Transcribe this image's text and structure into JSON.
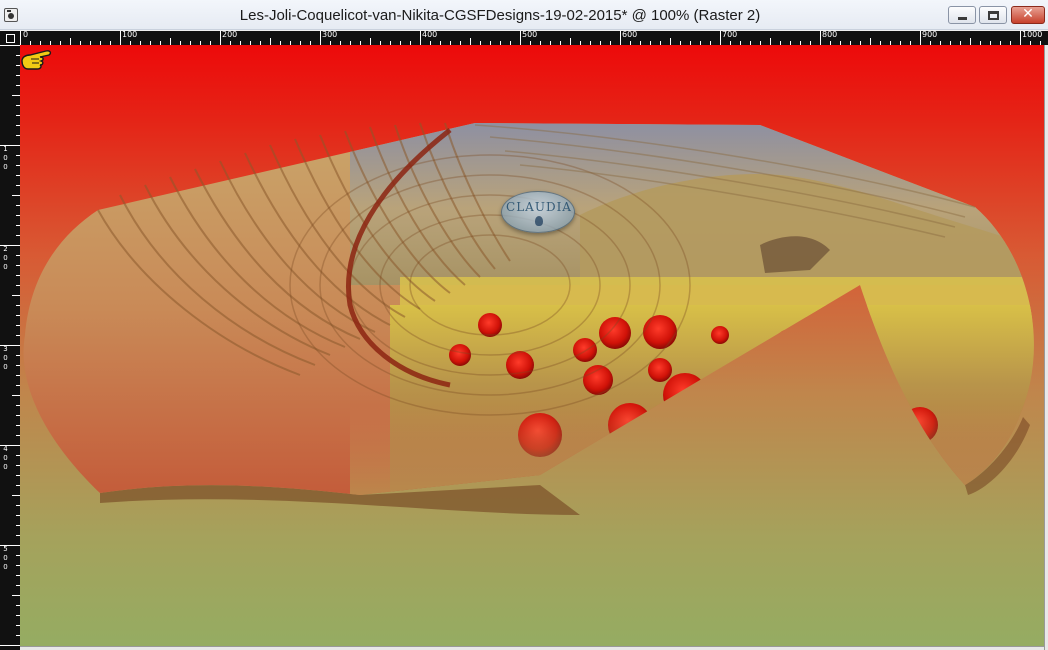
{
  "window": {
    "title": "Les-Joli-Coquelicot-van-Nikita-CGSFDesigns-19-02-2015* @ 100% (Raster 2)",
    "minimize_icon": "minimize-icon",
    "maximize_icon": "maximize-icon",
    "close_glyph": "✕"
  },
  "ruler": {
    "top_labels": [
      "0",
      "100",
      "200",
      "300",
      "400",
      "500",
      "600",
      "700",
      "800",
      "900",
      "1000"
    ],
    "left_labels": [
      [
        "1",
        "0",
        "0"
      ],
      [
        "2",
        "0",
        "0"
      ],
      [
        "3",
        "0",
        "0"
      ],
      [
        "4",
        "0",
        "0"
      ],
      [
        "5",
        "0",
        "0"
      ]
    ]
  },
  "canvas": {
    "watermark_text": "CLAUDIA",
    "cursor_icon": "pointing-hand-icon"
  },
  "colors": {
    "canvas_top": "#ed0a0a",
    "canvas_bottom": "#95ac62",
    "close_button": "#c7412c"
  }
}
